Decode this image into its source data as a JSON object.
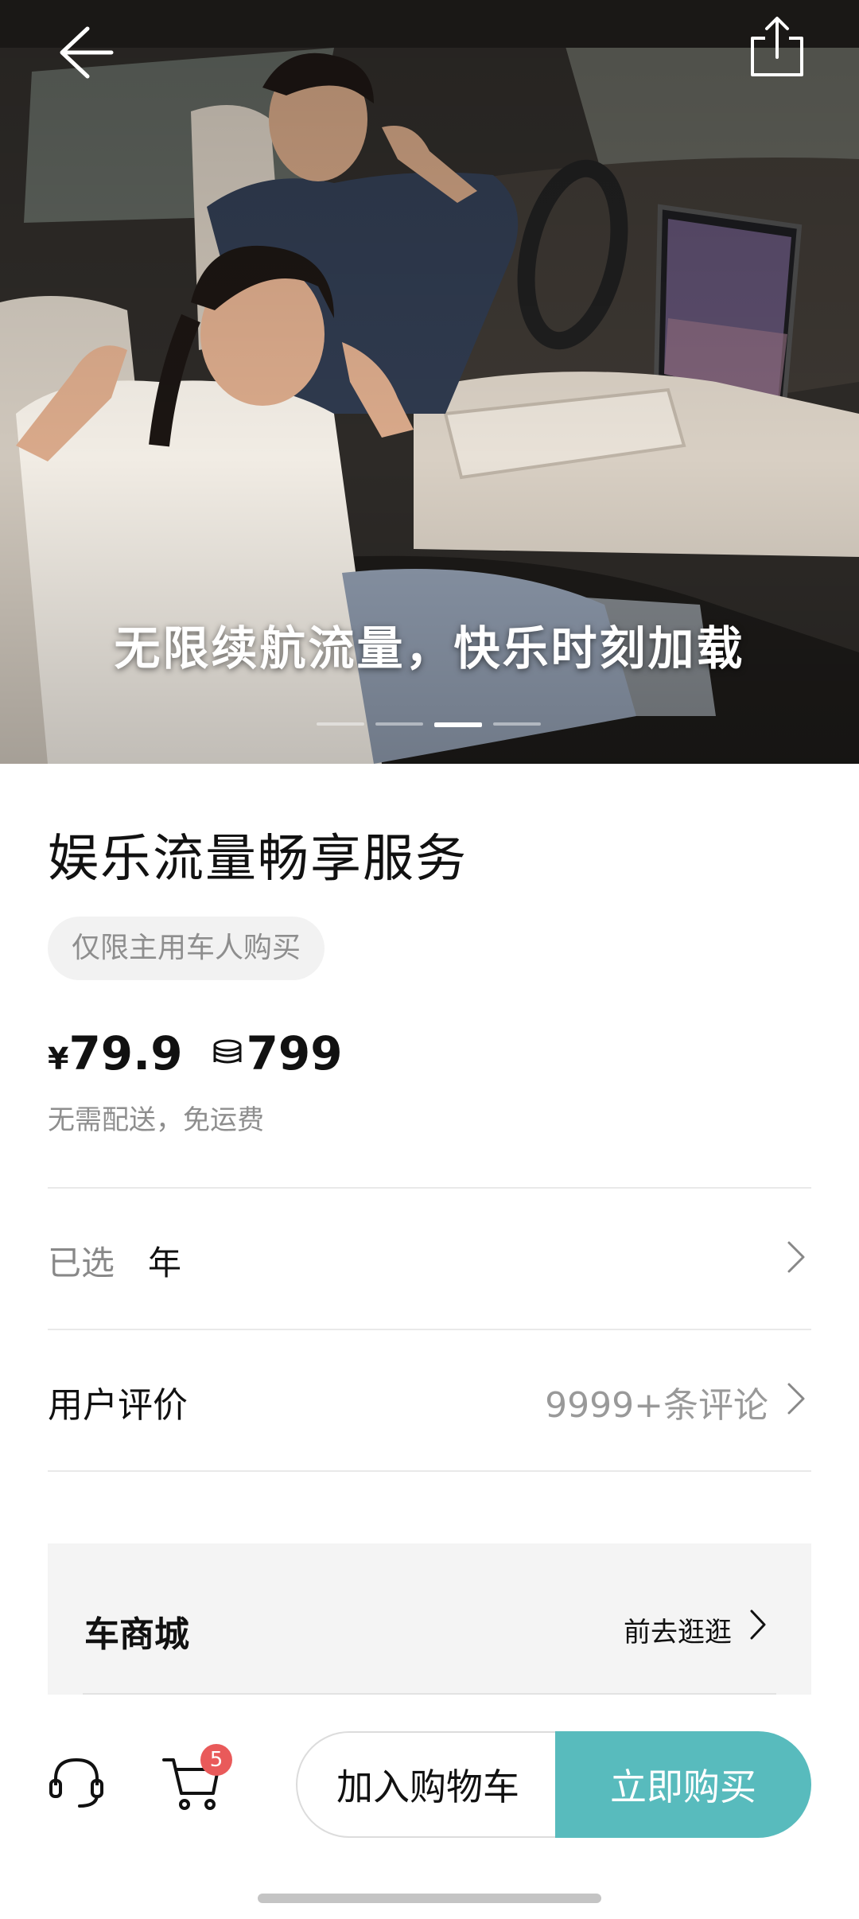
{
  "hero": {
    "caption": "无限续航流量，快乐时刻加载",
    "slide_count": 4,
    "active_slide": 3
  },
  "nav": {
    "back_icon": "arrow-left-icon",
    "share_icon": "share-icon"
  },
  "product": {
    "title": "娱乐流量畅享服务",
    "restriction_tag": "仅限主用车人购买",
    "price_symbol": "¥",
    "price": "79.9",
    "coin_icon": "coin-stack-icon",
    "coin_price": "799",
    "delivery_note": "无需配送，免运费"
  },
  "selection": {
    "label": "已选",
    "value": "年"
  },
  "reviews": {
    "label": "用户评价",
    "count_text": "9999+条评论"
  },
  "shop": {
    "title": "车商城",
    "link_text": "前去逛逛"
  },
  "bottom_bar": {
    "support_icon": "headset-icon",
    "cart_icon": "cart-icon",
    "cart_badge": "5",
    "add_to_cart": "加入购物车",
    "buy_now": "立即购买"
  },
  "colors": {
    "accent": "#58bbbd",
    "badge": "#e95a5a",
    "muted_text": "#8e8e8e"
  }
}
